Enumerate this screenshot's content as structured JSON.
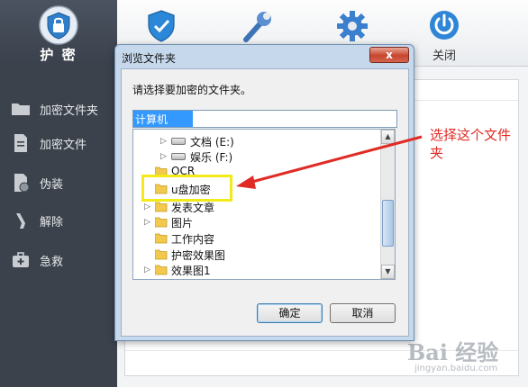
{
  "app": {
    "toolbar": [
      {
        "label": "护 密",
        "icon": "shield-lock-icon",
        "active": true
      },
      {
        "label": "",
        "icon": "shield-check-icon",
        "active": false
      },
      {
        "label": "",
        "icon": "wrench-icon",
        "active": false
      },
      {
        "label": "",
        "icon": "gear-icon",
        "active": false
      },
      {
        "label": "关闭",
        "icon": "power-icon",
        "active": false
      }
    ],
    "sidebar": [
      {
        "label": "加密文件夹",
        "icon": "folder-icon"
      },
      {
        "label": "加密文件",
        "icon": "document-icon"
      },
      {
        "label": "伪装",
        "icon": "disguise-icon"
      },
      {
        "label": "解除",
        "icon": "unlock-icon"
      },
      {
        "label": "急救",
        "icon": "first-aid-icon"
      }
    ]
  },
  "dialog": {
    "title": "浏览文件夹",
    "close_label": "x",
    "prompt": "请选择要加密的文件夹。",
    "path_value": "计算机",
    "tree": [
      {
        "label": "文档 (E:)",
        "type": "drive"
      },
      {
        "label": "娱乐 (F:)",
        "type": "drive"
      },
      {
        "label": "OCR",
        "type": "folder"
      },
      {
        "label": "u盘加密",
        "type": "folder"
      },
      {
        "label": "发表文章",
        "type": "folder"
      },
      {
        "label": "图片",
        "type": "folder"
      },
      {
        "label": "工作内容",
        "type": "folder"
      },
      {
        "label": "护密效果图",
        "type": "folder"
      },
      {
        "label": "效果图1",
        "type": "folder"
      }
    ],
    "ok_label": "确定",
    "cancel_label": "取消"
  },
  "annotation": {
    "text": "选择这个文件夹",
    "color": "#e02b26",
    "highlight_color": "#f3ea1a"
  },
  "watermark": {
    "brand": "Bai 经验",
    "url": "jingyan.baidu.com"
  }
}
